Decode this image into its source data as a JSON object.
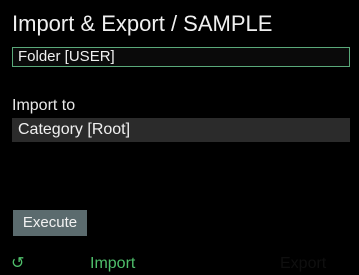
{
  "window": {
    "title": "Import & Export / SAMPLE"
  },
  "source": {
    "folder_value": "Folder [USER]"
  },
  "destination": {
    "label": "Import to",
    "category_value": "Category [Root]"
  },
  "actions": {
    "execute_label": "Execute"
  },
  "footer": {
    "refresh_icon": "↺",
    "tabs": [
      {
        "label": "Import",
        "active": true
      },
      {
        "label": "Export",
        "active": false
      }
    ]
  },
  "colors": {
    "accent": "#4fbf6b",
    "field_border": "#5aa97a",
    "button_bg": "#5b6b6e"
  }
}
